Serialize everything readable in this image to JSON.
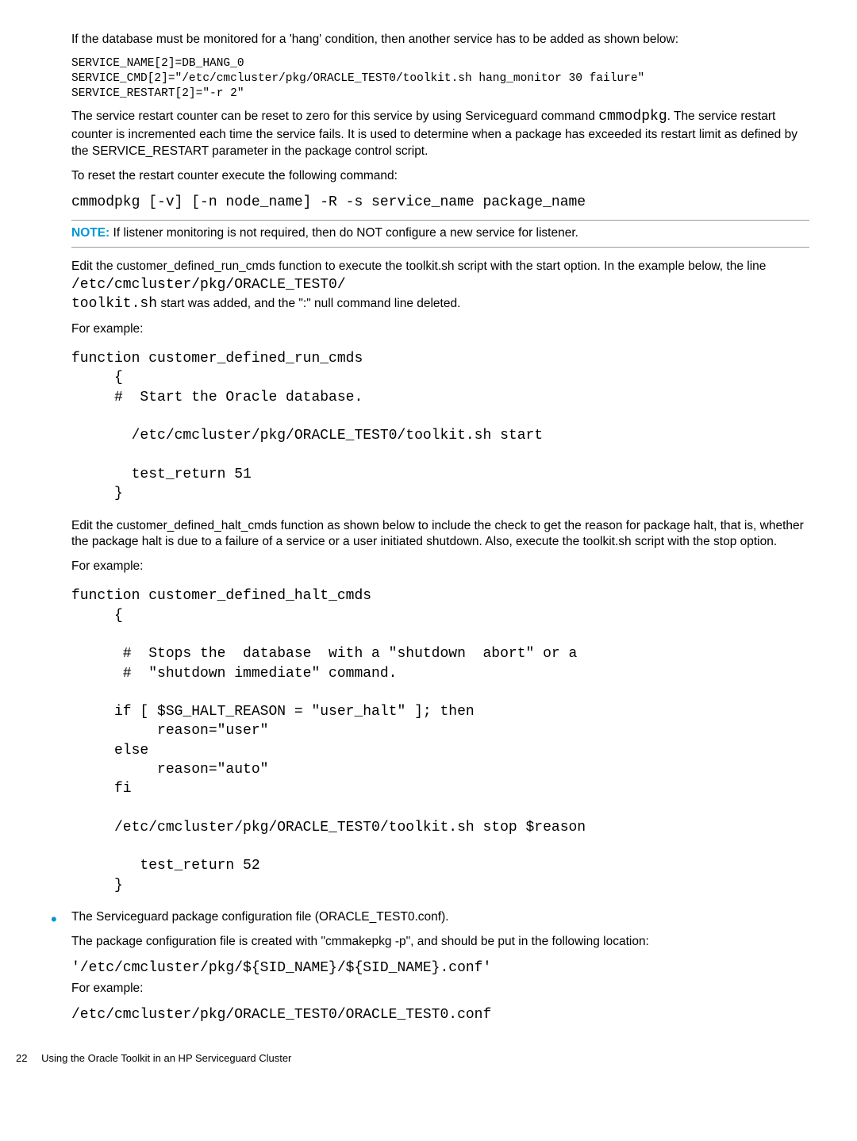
{
  "p1": "If the database must be monitored for a 'hang' condition, then another service has to be added as shown below:",
  "code1": "SERVICE_NAME[2]=DB_HANG_0\nSERVICE_CMD[2]=\"/etc/cmcluster/pkg/ORACLE_TEST0/toolkit.sh hang_monitor 30 failure\"\nSERVICE_RESTART[2]=\"-r 2\"",
  "p2a": "The service restart counter can be reset to zero for this service by using Serviceguard command ",
  "p2code": "cmmodpkg",
  "p2b": ". The service restart counter is incremented each time the service fails. It is used to determine when a package has exceeded its restart limit as defined by the SERVICE_RESTART parameter in the package control script.",
  "p3": "To reset the restart counter execute the following command:",
  "code2": "cmmodpkg [-v] [-n node_name] -R -s service_name package_name",
  "note_label": "NOTE:",
  "note_text": "If listener monitoring is not required, then do NOT configure a new service for listener.",
  "p4a": "Edit the customer_defined_run_cmds function to execute the toolkit.sh script with the start option. In the example below, the line ",
  "p4code1": "/etc/cmcluster/pkg/ORACLE_TEST0/",
  "p4code2": "toolkit.sh",
  "p4b": " start was added, and the \":\" null command line deleted.",
  "p5": "For example:",
  "code3": "function customer_defined_run_cmds\n     {\n     #  Start the Oracle database.\n\n       /etc/cmcluster/pkg/ORACLE_TEST0/toolkit.sh start\n\n       test_return 51\n     }",
  "p6": "Edit the customer_defined_halt_cmds function as shown below to include the check to get the reason for package halt, that is, whether the package halt is due to a failure of a service or a user initiated shutdown. Also, execute the toolkit.sh script with the stop option.",
  "p7": "For example:",
  "code4": "function customer_defined_halt_cmds\n     {\n\n      #  Stops the  database  with a \"shutdown  abort\" or a\n      #  \"shutdown immediate\" command.\n\n     if [ $SG_HALT_REASON = \"user_halt\" ]; then\n          reason=\"user\"\n     else\n          reason=\"auto\"\n     fi\n\n     /etc/cmcluster/pkg/ORACLE_TEST0/toolkit.sh stop $reason\n\n        test_return 52\n     }",
  "bullet1": "The Serviceguard package configuration file (ORACLE_TEST0.conf).",
  "p8": "The package configuration file is created with \"cmmakepkg -p\", and should be put in the following location:",
  "code5": "'/etc/cmcluster/pkg/${SID_NAME}/${SID_NAME}.conf'",
  "p9": "For example:",
  "code6": "/etc/cmcluster/pkg/ORACLE_TEST0/ORACLE_TEST0.conf",
  "footer_page": "22",
  "footer_text": "Using the Oracle Toolkit in an HP Serviceguard Cluster"
}
